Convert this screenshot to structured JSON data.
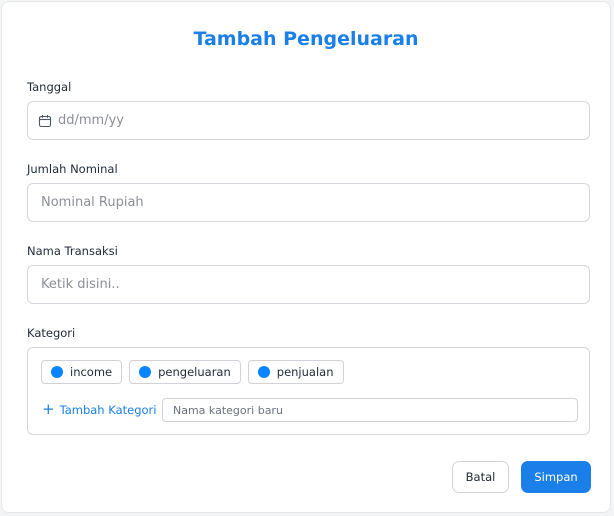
{
  "form": {
    "title": "Tambah Pengeluaran",
    "date": {
      "label": "Tanggal",
      "placeholder": "dd/mm/yy",
      "icon": "calendar-icon"
    },
    "amount": {
      "label": "Jumlah Nominal",
      "placeholder": "Nominal Rupiah"
    },
    "transaction_name": {
      "label": "Nama Transaksi",
      "placeholder": "Ketik disini.."
    },
    "category": {
      "label": "Kategori",
      "options": [
        {
          "label": "income",
          "color": "#0a84ff"
        },
        {
          "label": "pengeluaran",
          "color": "#0a84ff"
        },
        {
          "label": "penjualan",
          "color": "#0a84ff"
        }
      ],
      "add_label": "Tambah Kategori",
      "add_icon": "plus-icon",
      "new_placeholder": "Nama kategori baru"
    },
    "buttons": {
      "cancel": "Batal",
      "save": "Simpan"
    }
  },
  "colors": {
    "accent": "#1a7fe8",
    "chip_dot": "#0a84ff"
  }
}
